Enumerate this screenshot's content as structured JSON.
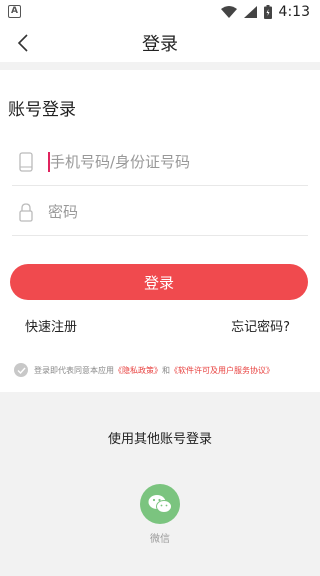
{
  "status": {
    "time": "4:13",
    "left_badge": "A"
  },
  "header": {
    "title": "登录"
  },
  "login": {
    "section_title": "账号登录",
    "phone_placeholder": "手机号码/身份证号码",
    "password_placeholder": "密码",
    "submit_label": "登录",
    "register_link": "快速注册",
    "forgot_link": "忘记密码?"
  },
  "agreement": {
    "prefix": "登录即代表同意本应用",
    "privacy_link": "《隐私政策》",
    "conjunction": "和",
    "terms_link": "《软件许可及用户服务协议》"
  },
  "other_login": {
    "title": "使用其他账号登录",
    "wechat_label": "微信"
  },
  "colors": {
    "accent": "#f04a4e",
    "link": "#e8413f",
    "wechat": "#7bc47f"
  }
}
